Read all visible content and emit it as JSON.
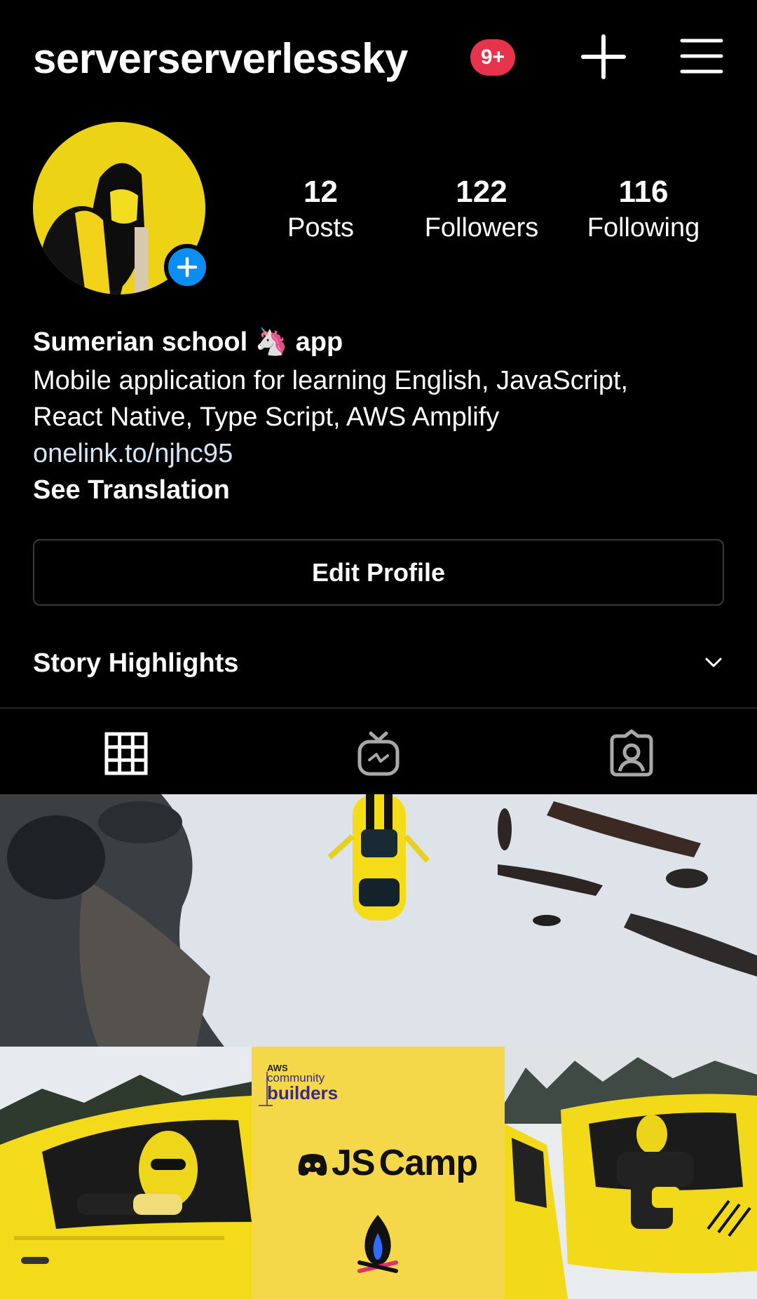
{
  "header": {
    "username": "serverserverlessky",
    "notification_badge": "9+",
    "create_icon": "plus-icon",
    "menu_icon": "hamburger-menu-icon"
  },
  "profile": {
    "stats": [
      {
        "value": "12",
        "label": "Posts"
      },
      {
        "value": "122",
        "label": "Followers"
      },
      {
        "value": "116",
        "label": "Following"
      }
    ],
    "name_part1": "Sumerian school",
    "name_emoji": "🦄",
    "name_part2": "app",
    "bio_line1": "Mobile application for learning English, JavaScript,",
    "bio_line2": "React Native, Type Script, AWS Amplify",
    "link": "onelink.to/njhc95",
    "see_translation": "See Translation",
    "edit_profile": "Edit Profile",
    "story_highlights": "Story Highlights"
  },
  "tabs": [
    {
      "icon": "grid-icon",
      "active": true
    },
    {
      "icon": "igtv-icon",
      "active": false
    },
    {
      "icon": "tagged-icon",
      "active": false
    }
  ],
  "posts": {
    "aws_small": "AWS",
    "aws_community": "community",
    "aws_builders": "builders",
    "jscamp_js": "JS",
    "jscamp_camp": "Camp"
  },
  "colors": {
    "accent_blue": "#0b8ef1",
    "badge_red": "#e8334d",
    "link_color": "#d5e5f9",
    "yellow": "#f4d84a"
  }
}
